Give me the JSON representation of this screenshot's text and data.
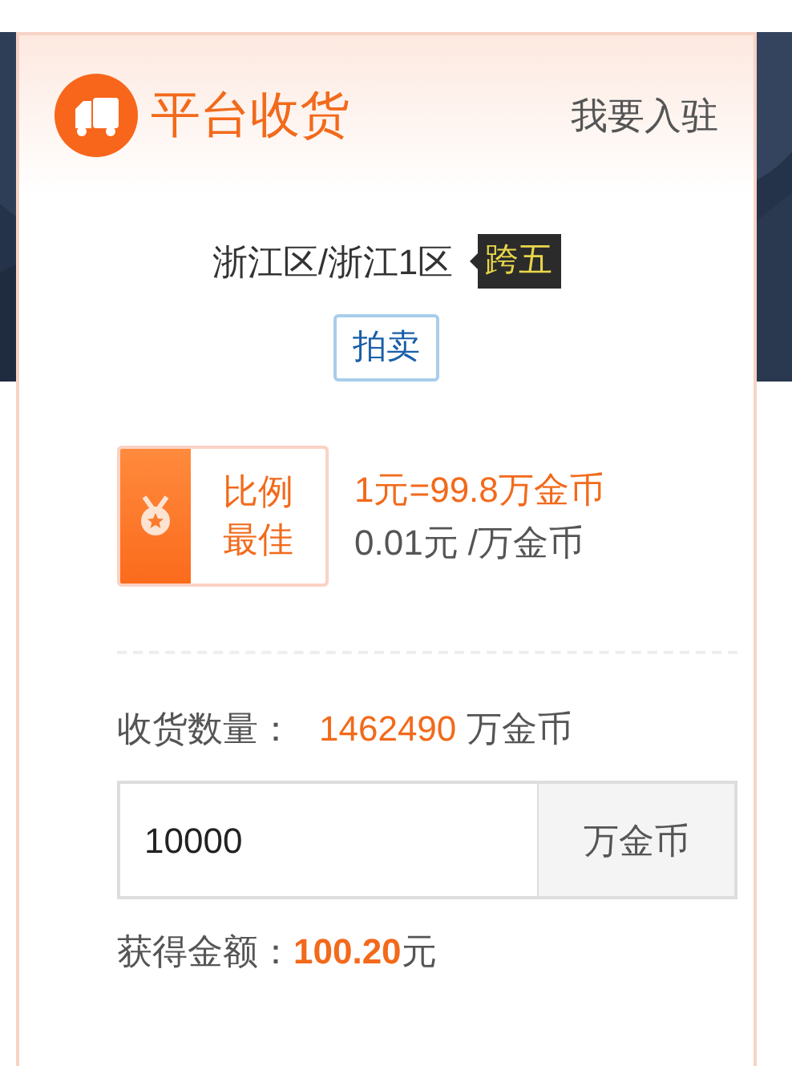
{
  "header": {
    "title": "平台收货",
    "link": "我要入驻"
  },
  "server": {
    "name": "浙江区/浙江1区",
    "tag": "跨五"
  },
  "mode": "拍卖",
  "rate": {
    "badge_lines": [
      "比例",
      "最佳"
    ],
    "main": "1元=99.8万金币",
    "unit_price": "0.01元 /万金币"
  },
  "quantity": {
    "label": "收货数量：",
    "value": "1462490",
    "unit": "万金币"
  },
  "amount_input": {
    "value": "10000",
    "unit": "万金币"
  },
  "payout": "获得金额：**100.20**元"
}
